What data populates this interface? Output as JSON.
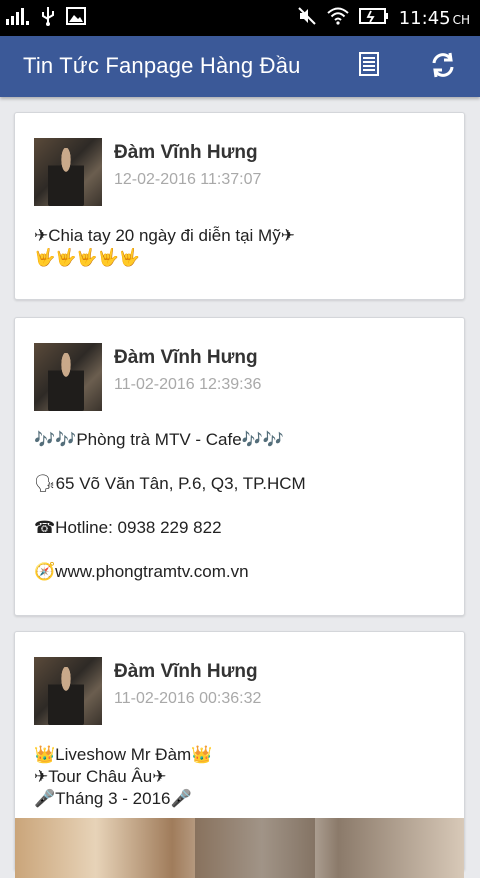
{
  "status_bar": {
    "time": "11:45",
    "time_suffix": "CH",
    "icons": [
      "signal-icon",
      "usb-icon",
      "gallery-icon",
      "mute-icon",
      "wifi-icon",
      "battery-icon"
    ]
  },
  "app_bar": {
    "title": "Tin Tức Fanpage Hàng Đầu",
    "icons": [
      "list-icon",
      "refresh-icon"
    ]
  },
  "posts": [
    {
      "author": "Đàm Vĩnh Hưng",
      "time": "12-02-2016 11:37:07",
      "lines": [
        "✈Chia tay 20 ngày đi diễn tại Mỹ✈",
        "🤟🤟🤟🤟🤟"
      ]
    },
    {
      "author": "Đàm Vĩnh Hưng",
      "time": "11-02-2016 12:39:36",
      "lines": [
        "🎶🎶Phòng trà MTV - Cafe🎶🎶",
        "🗣65 Võ Văn Tân, P.6, Q3, TP.HCM",
        "☎Hotline: 0938 229 822",
        "🧭www.phongtramtv.com.vn"
      ]
    },
    {
      "author": "Đàm Vĩnh Hưng",
      "time": "11-02-2016 00:36:32",
      "lines": [
        "👑Liveshow Mr Đàm👑",
        "✈Tour Châu Âu✈",
        "🎤Tháng 3 - 2016🎤"
      ]
    }
  ],
  "colors": {
    "app_bar": "#3b5998",
    "background": "#e9eaed",
    "timestamp": "#a9a9a9"
  }
}
